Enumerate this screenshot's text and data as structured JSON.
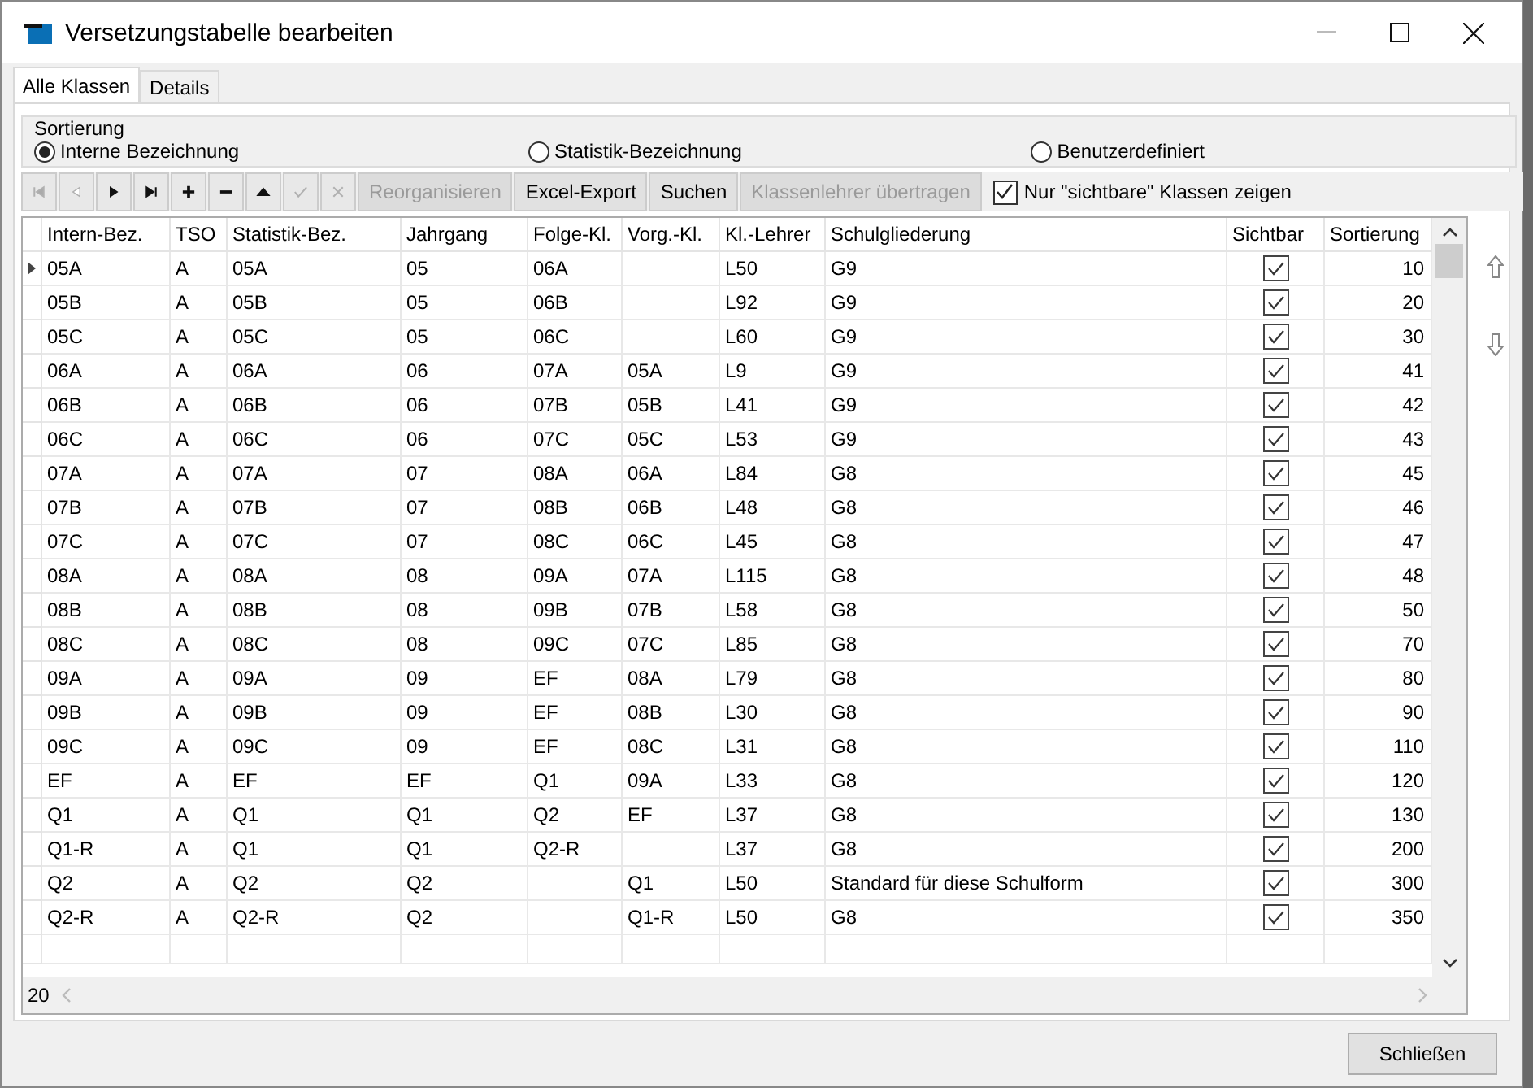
{
  "window": {
    "title": "Versetzungstabelle bearbeiten"
  },
  "tabs": [
    {
      "label": "Alle Klassen",
      "selected": true
    },
    {
      "label": "Details",
      "selected": false
    }
  ],
  "sorting": {
    "label": "Sortierung",
    "options": [
      {
        "label": "Interne Bezeichnung",
        "selected": true
      },
      {
        "label": "Statistik-Bezeichnung",
        "selected": false
      },
      {
        "label": "Benutzerdefiniert",
        "selected": false
      }
    ]
  },
  "navigator": [
    {
      "kind": "first",
      "disabled": true
    },
    {
      "kind": "prev",
      "disabled": true
    },
    {
      "kind": "next",
      "disabled": false
    },
    {
      "kind": "last",
      "disabled": false
    },
    {
      "kind": "insert",
      "disabled": false
    },
    {
      "kind": "delete",
      "disabled": false
    },
    {
      "kind": "edit",
      "disabled": false
    },
    {
      "kind": "post",
      "disabled": true
    },
    {
      "kind": "cancel",
      "disabled": true
    }
  ],
  "buttons": [
    {
      "label": "Reorganisieren",
      "disabled": true
    },
    {
      "label": "Excel-Export",
      "disabled": false
    },
    {
      "label": "Suchen",
      "disabled": false
    },
    {
      "label": "Klassenlehrer übertragen",
      "disabled": true
    }
  ],
  "visible_only": {
    "label": "Nur \"sichtbare\" Klassen zeigen",
    "checked": true
  },
  "table": {
    "columns": [
      "Intern-Bez.",
      "TSO",
      "Statistik-Bez.",
      "Jahrgang",
      "Folge-Kl.",
      "Vorg.-Kl.",
      "Kl.-Lehrer",
      "Schulgliederung",
      "Sichtbar",
      "Sortierung"
    ],
    "rows": [
      {
        "current": true,
        "cells": [
          "05A",
          "A",
          "05A",
          "05",
          "06A",
          "",
          "L50",
          "G9"
        ],
        "visible": true,
        "sort": "10"
      },
      {
        "current": false,
        "cells": [
          "05B",
          "A",
          "05B",
          "05",
          "06B",
          "",
          "L92",
          "G9"
        ],
        "visible": true,
        "sort": "20"
      },
      {
        "current": false,
        "cells": [
          "05C",
          "A",
          "05C",
          "05",
          "06C",
          "",
          "L60",
          "G9"
        ],
        "visible": true,
        "sort": "30"
      },
      {
        "current": false,
        "cells": [
          "06A",
          "A",
          "06A",
          "06",
          "07A",
          "05A",
          "L9",
          "G9"
        ],
        "visible": true,
        "sort": "41"
      },
      {
        "current": false,
        "cells": [
          "06B",
          "A",
          "06B",
          "06",
          "07B",
          "05B",
          "L41",
          "G9"
        ],
        "visible": true,
        "sort": "42"
      },
      {
        "current": false,
        "cells": [
          "06C",
          "A",
          "06C",
          "06",
          "07C",
          "05C",
          "L53",
          "G9"
        ],
        "visible": true,
        "sort": "43"
      },
      {
        "current": false,
        "cells": [
          "07A",
          "A",
          "07A",
          "07",
          "08A",
          "06A",
          "L84",
          "G8"
        ],
        "visible": true,
        "sort": "45"
      },
      {
        "current": false,
        "cells": [
          "07B",
          "A",
          "07B",
          "07",
          "08B",
          "06B",
          "L48",
          "G8"
        ],
        "visible": true,
        "sort": "46"
      },
      {
        "current": false,
        "cells": [
          "07C",
          "A",
          "07C",
          "07",
          "08C",
          "06C",
          "L45",
          "G8"
        ],
        "visible": true,
        "sort": "47"
      },
      {
        "current": false,
        "cells": [
          "08A",
          "A",
          "08A",
          "08",
          "09A",
          "07A",
          "L115",
          "G8"
        ],
        "visible": true,
        "sort": "48"
      },
      {
        "current": false,
        "cells": [
          "08B",
          "A",
          "08B",
          "08",
          "09B",
          "07B",
          "L58",
          "G8"
        ],
        "visible": true,
        "sort": "50"
      },
      {
        "current": false,
        "cells": [
          "08C",
          "A",
          "08C",
          "08",
          "09C",
          "07C",
          "L85",
          "G8"
        ],
        "visible": true,
        "sort": "70"
      },
      {
        "current": false,
        "cells": [
          "09A",
          "A",
          "09A",
          "09",
          "EF",
          "08A",
          "L79",
          "G8"
        ],
        "visible": true,
        "sort": "80"
      },
      {
        "current": false,
        "cells": [
          "09B",
          "A",
          "09B",
          "09",
          "EF",
          "08B",
          "L30",
          "G8"
        ],
        "visible": true,
        "sort": "90"
      },
      {
        "current": false,
        "cells": [
          "09C",
          "A",
          "09C",
          "09",
          "EF",
          "08C",
          "L31",
          "G8"
        ],
        "visible": true,
        "sort": "110"
      },
      {
        "current": false,
        "cells": [
          "EF",
          "A",
          "EF",
          "EF",
          "Q1",
          "09A",
          "L33",
          "G8"
        ],
        "visible": true,
        "sort": "120"
      },
      {
        "current": false,
        "cells": [
          "Q1",
          "A",
          "Q1",
          "Q1",
          "Q2",
          "EF",
          "L37",
          "G8"
        ],
        "visible": true,
        "sort": "130"
      },
      {
        "current": false,
        "cells": [
          "Q1-R",
          "A",
          "Q1",
          "Q1",
          "Q2-R",
          "",
          "L37",
          "G8"
        ],
        "visible": true,
        "sort": "200"
      },
      {
        "current": false,
        "cells": [
          "Q2",
          "A",
          "Q2",
          "Q2",
          "",
          "Q1",
          "L50",
          "Standard für diese Schulform"
        ],
        "visible": true,
        "sort": "300"
      },
      {
        "current": false,
        "cells": [
          "Q2-R",
          "A",
          "Q2-R",
          "Q2",
          "",
          "Q1-R",
          "L50",
          "G8"
        ],
        "visible": true,
        "sort": "350"
      }
    ]
  },
  "record_count": "20",
  "close_button": "Schließen"
}
